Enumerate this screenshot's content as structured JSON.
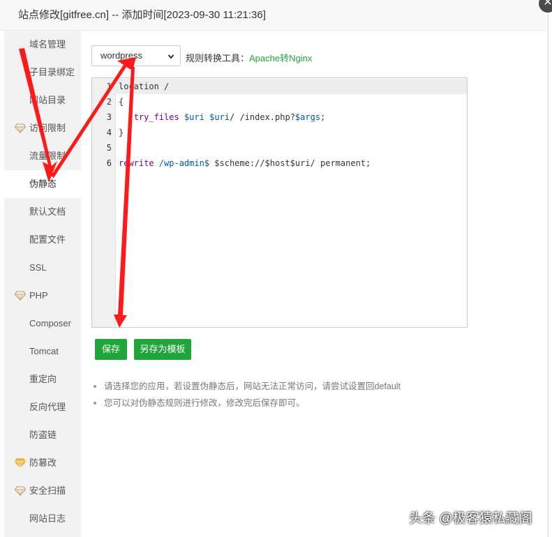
{
  "dialog": {
    "title": "站点修改[gitfree.cn] -- 添加时间[2023-09-30 11:21:36]",
    "close_symbol": "✕"
  },
  "sidebar": {
    "items": [
      {
        "label": "域名管理",
        "icon": ""
      },
      {
        "label": "子目录绑定",
        "icon": ""
      },
      {
        "label": "网站目录",
        "icon": ""
      },
      {
        "label": "访问限制",
        "icon": "gem-icon"
      },
      {
        "label": "流量限制",
        "icon": ""
      },
      {
        "label": "伪静态",
        "icon": "",
        "active": true
      },
      {
        "label": "默认文档",
        "icon": ""
      },
      {
        "label": "配置文件",
        "icon": ""
      },
      {
        "label": "SSL",
        "icon": ""
      },
      {
        "label": "PHP",
        "icon": "gem-icon"
      },
      {
        "label": "Composer",
        "icon": ""
      },
      {
        "label": "Tomcat",
        "icon": ""
      },
      {
        "label": "重定向",
        "icon": ""
      },
      {
        "label": "反向代理",
        "icon": ""
      },
      {
        "label": "防盗链",
        "icon": ""
      },
      {
        "label": "防篡改",
        "icon": "gem-icon-gold"
      },
      {
        "label": "安全扫描",
        "icon": "gem-icon"
      },
      {
        "label": "网站日志",
        "icon": ""
      }
    ]
  },
  "rewrite": {
    "selected_app": "wordpress",
    "tool_label": "规则转换工具：",
    "tool_link": "Apache转Nginx"
  },
  "editor": {
    "line_numbers": [
      "1",
      "2",
      "3",
      "4",
      "5",
      "6"
    ],
    "line1": "location /",
    "line2": "{",
    "line3_indent": "   ",
    "line3_kw": "try_files",
    "line3_v1": "$uri",
    "line3_v2": "$uri",
    "line3_mid": "/ /index.php?",
    "line3_v3": "$args",
    "line3_end": ";",
    "line4": "}",
    "line6_kw": "rewrite",
    "line6_pattern": " /wp-admin$ ",
    "line6_rest": "$scheme://$host$uri/ permanent;"
  },
  "buttons": {
    "save": "保存",
    "save_template": "另存为模板"
  },
  "tips": [
    "请选择您的应用，若设置伪静态后，网站无法正常访问，请尝试设置回default",
    "您可以对伪静态规则进行修改，修改完后保存即可。"
  ],
  "watermark": "头条 @极客猿私藏阁",
  "colors": {
    "accent_green": "#20a53a",
    "annotation_red": "#ff1a1a",
    "gem_gold": "#e6a23c"
  }
}
